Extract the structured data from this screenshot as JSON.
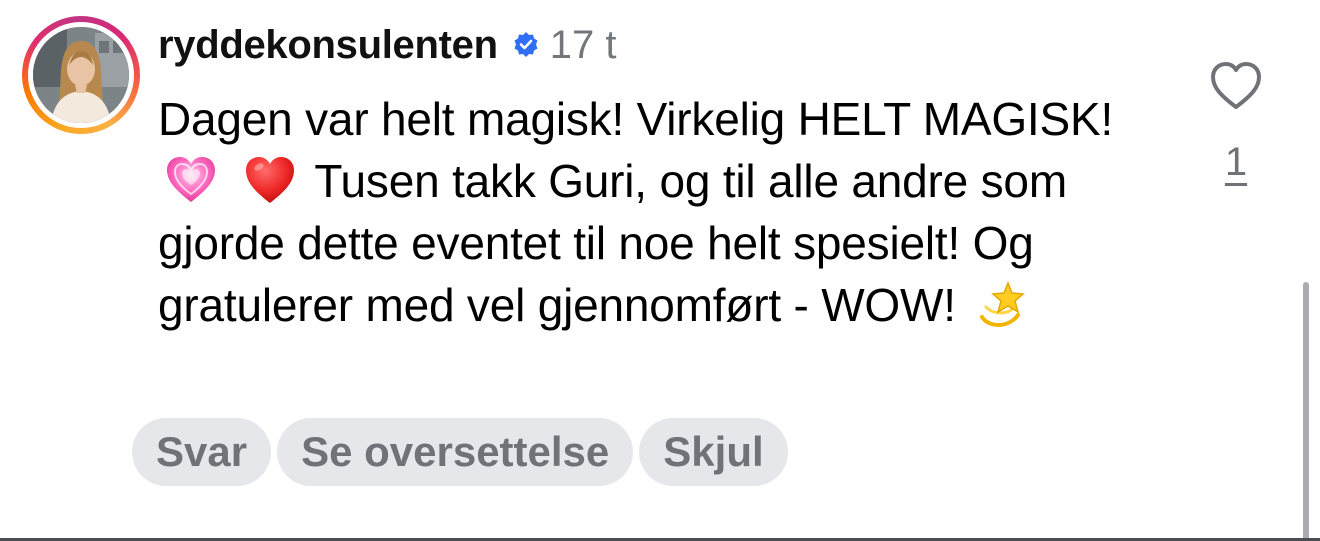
{
  "comment": {
    "username": "ryddekonsulenten",
    "verified": true,
    "timestamp": "17 t",
    "text": {
      "part1": "Dagen var helt magisk! Virkelig HELT MAGISK!",
      "emoji1": "sparkling-heart",
      "emoji2": "red-heart",
      "part2": "Tusen takk Guri, og til alle andre som gjorde dette eventet til noe helt spesielt! Og gratulerer med vel gjennomført - WOW!",
      "emoji3": "dizzy-star"
    },
    "actions": {
      "reply_label": "Svar",
      "translate_label": "Se oversettelse",
      "hide_label": "Skjul"
    },
    "likes": {
      "icon": "heart-outline-icon",
      "count": "1"
    }
  },
  "colors": {
    "verified_badge": "#2f6ef5",
    "pill_background": "#e6e7ea",
    "pill_text": "#6f7378",
    "timestamp": "#73767a"
  }
}
